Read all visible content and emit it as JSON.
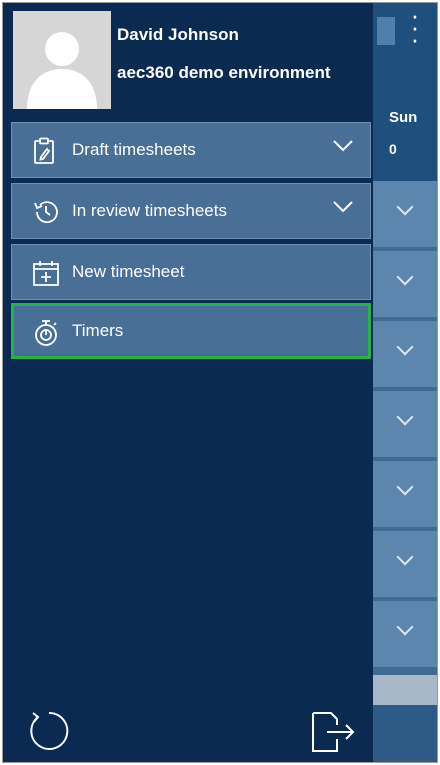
{
  "user": {
    "name": "David Johnson",
    "environment": "aec360 demo environment",
    "avatar_icon": "user-silhouette-icon"
  },
  "menu": {
    "items": [
      {
        "label": "Draft timesheets",
        "icon": "clipboard-edit-icon",
        "expandable": true
      },
      {
        "label": "In review timesheets",
        "icon": "history-icon",
        "expandable": true
      },
      {
        "label": "New timesheet",
        "icon": "calendar-add-icon",
        "expandable": false
      },
      {
        "label": "Timers",
        "icon": "stopwatch-icon",
        "expandable": false,
        "selected": true
      }
    ]
  },
  "background_app": {
    "day_label": "Sun",
    "day_value": "0",
    "row_count": 7
  },
  "footer": {
    "refresh_icon": "refresh-icon",
    "signout_icon": "sign-out-icon"
  },
  "colors": {
    "drawer_bg": "#0b2a52",
    "menu_item_bg": "#4a6f97",
    "selected_border": "#24b34a",
    "text": "#ffffff"
  }
}
